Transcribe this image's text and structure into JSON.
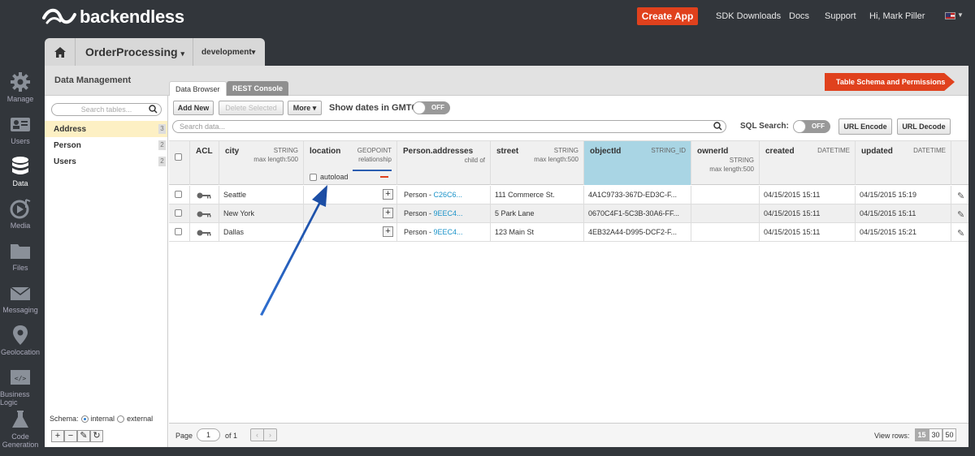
{
  "brand": {
    "name": "backendless"
  },
  "topbar": {
    "create_app": "Create App",
    "nav": [
      "SDK Downloads",
      "Docs",
      "Support",
      "Hi, Mark Piller"
    ]
  },
  "app": {
    "name": "OrderProcessing",
    "version": "development"
  },
  "leftnav": [
    {
      "label": "Manage",
      "icon": "gear-icon"
    },
    {
      "label": "Users",
      "icon": "users-icon"
    },
    {
      "label": "Data",
      "icon": "database-icon"
    },
    {
      "label": "Media",
      "icon": "media-icon"
    },
    {
      "label": "Files",
      "icon": "folder-icon"
    },
    {
      "label": "Messaging",
      "icon": "envelope-icon"
    },
    {
      "label": "Geolocation",
      "icon": "pin-icon"
    },
    {
      "label": "Business Logic",
      "icon": "code-icon"
    },
    {
      "label": "Code Generation",
      "icon": "flask-icon"
    }
  ],
  "data_mgmt": {
    "title": "Data Management",
    "tabs": [
      "Data Browser",
      "REST Console"
    ],
    "schema_button": "Table Schema and Permissions",
    "search_tables_placeholder": "Search tables...",
    "tables": [
      {
        "name": "Address",
        "count": "3"
      },
      {
        "name": "Person",
        "count": "2"
      },
      {
        "name": "Users",
        "count": "2"
      }
    ],
    "schema": {
      "label": "Schema:",
      "internal": "internal",
      "external": "external"
    }
  },
  "toolbar": {
    "add_new": "Add New",
    "delete_selected": "Delete Selected",
    "more": "More",
    "gmt_label": "Show dates in GMT0:",
    "gmt_toggle": "OFF",
    "search_placeholder": "Search data...",
    "sql_label": "SQL Search:",
    "sql_toggle": "OFF",
    "url_encode": "URL Encode",
    "url_decode": "URL Decode"
  },
  "columns": {
    "acl": "ACL",
    "city": {
      "name": "city",
      "type": "STRING",
      "sub": "max length:500"
    },
    "location": {
      "name": "location",
      "type": "GEOPOINT",
      "sub": "relationship",
      "autoload": "autoload"
    },
    "person": {
      "name": "Person.addresses",
      "sub": "child of"
    },
    "street": {
      "name": "street",
      "type": "STRING",
      "sub": "max length:500"
    },
    "objectId": {
      "name": "objectId",
      "type": "STRING_ID"
    },
    "ownerId": {
      "name": "ownerId",
      "type": "STRING",
      "sub": "max length:500"
    },
    "created": {
      "name": "created",
      "type": "DATETIME"
    },
    "updated": {
      "name": "updated",
      "type": "DATETIME"
    }
  },
  "rows": [
    {
      "city": "Seattle",
      "person_prefix": "Person - ",
      "person_link": "C26C6...",
      "street": "111 Commerce St.",
      "objectId": "4A1C9733-367D-ED3C-F...",
      "created": "04/15/2015 15:11",
      "updated": "04/15/2015 15:19"
    },
    {
      "city": "New York",
      "person_prefix": "Person - ",
      "person_link": "9EEC4...",
      "street": "5 Park Lane",
      "objectId": "0670C4F1-5C3B-30A6-FF...",
      "created": "04/15/2015 15:11",
      "updated": "04/15/2015 15:11"
    },
    {
      "city": "Dallas",
      "person_prefix": "Person - ",
      "person_link": "9EEC4...",
      "street": "123 Main St",
      "objectId": "4EB32A44-D995-DCF2-F...",
      "created": "04/15/2015 15:11",
      "updated": "04/15/2015 15:21"
    }
  ],
  "footer": {
    "page_label": "Page",
    "page_value": "1",
    "of_label": "of 1",
    "view_rows": "View rows:",
    "row_options": [
      "15",
      "30",
      "50"
    ]
  }
}
